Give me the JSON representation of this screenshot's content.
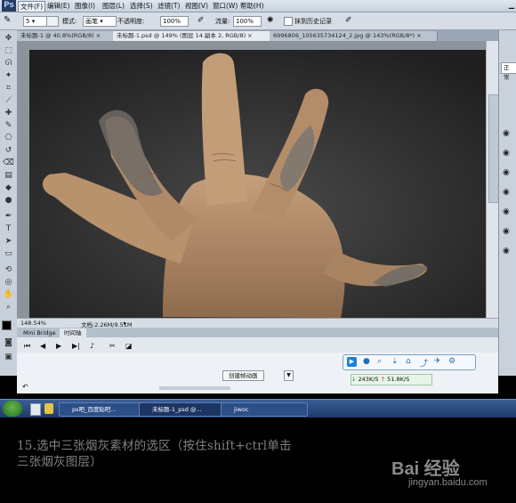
{
  "app": {
    "logo": "Ps"
  },
  "menu": [
    "文件(F)",
    "编辑(E)",
    "图像(I)",
    "图层(L)",
    "选择(S)",
    "滤镜(T)",
    "视图(V)",
    "窗口(W)",
    "帮助(H)"
  ],
  "options": {
    "mode_label": "模式:",
    "mode_value": "画笔",
    "opacity_label": "不透明度:",
    "opacity_value": "100%",
    "flow_label": "流量:",
    "flow_value": "100%",
    "erase_history": "抹到历史记录",
    "brush_size": "5"
  },
  "tabs": [
    "未标题-1 @ 40.8%(RGB/8) ×",
    "未标题-1.psd @ 149% (图层 14 副本 2, RGB/8) ×",
    "6996806_105635734124_2.jpg @ 143%(RGB/8*) ×"
  ],
  "status": {
    "zoom": "148.54%",
    "doc": "文档:2.26M/9.51M"
  },
  "panel_tabs": [
    "Mini Bridge",
    "时间轴"
  ],
  "timeline": {
    "create_button": "创建帧动画"
  },
  "qq": {
    "download": "243K/S",
    "upload": "51.8K/S"
  },
  "taskbar": {
    "items": [
      "ps吧_百度贴吧...",
      "未标题-1_psd @...",
      "jiwoc"
    ]
  },
  "right_panel": {
    "label": "正常"
  },
  "caption": {
    "line1": "15.选中三张烟灰素材的选区（按住shift+ctrl单击",
    "line2": "三张烟灰图层）"
  },
  "watermark": {
    "logo": "Bai 经验",
    "url": "jingyan.baidu.com"
  },
  "colors": {
    "accent": "#2a3b5e",
    "canvas_bg": "#2e2e2e",
    "skin": "#b08b68"
  }
}
